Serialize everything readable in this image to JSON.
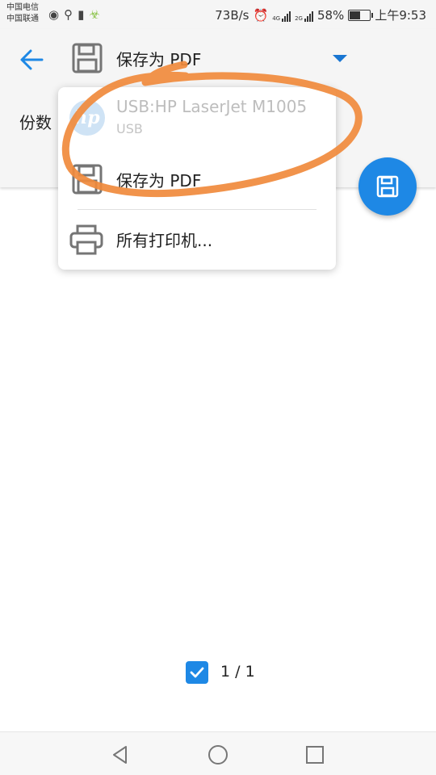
{
  "status_bar": {
    "carrier_1": "中国电信",
    "carrier_2": "中国联通",
    "speed": "73B/s",
    "network_1": "4G",
    "network_2": "2G",
    "battery_percent": "58%",
    "battery_level": 0.58,
    "time": "上午9:53"
  },
  "header": {
    "selected_printer": "保存为 PDF",
    "copies_label": "份数"
  },
  "printer_menu": {
    "items": [
      {
        "title": "USB:HP LaserJet M1005",
        "subtitle": "USB",
        "icon": "hp-logo-icon",
        "disabled": true
      },
      {
        "title": "保存为 PDF",
        "icon": "save-pdf-icon"
      },
      {
        "title": "所有打印机...",
        "icon": "printer-icon"
      }
    ]
  },
  "page_selector": {
    "checked": true,
    "count": "1 / 1"
  },
  "colors": {
    "accent": "#1e88e5",
    "annotation": "#f08a3c"
  }
}
